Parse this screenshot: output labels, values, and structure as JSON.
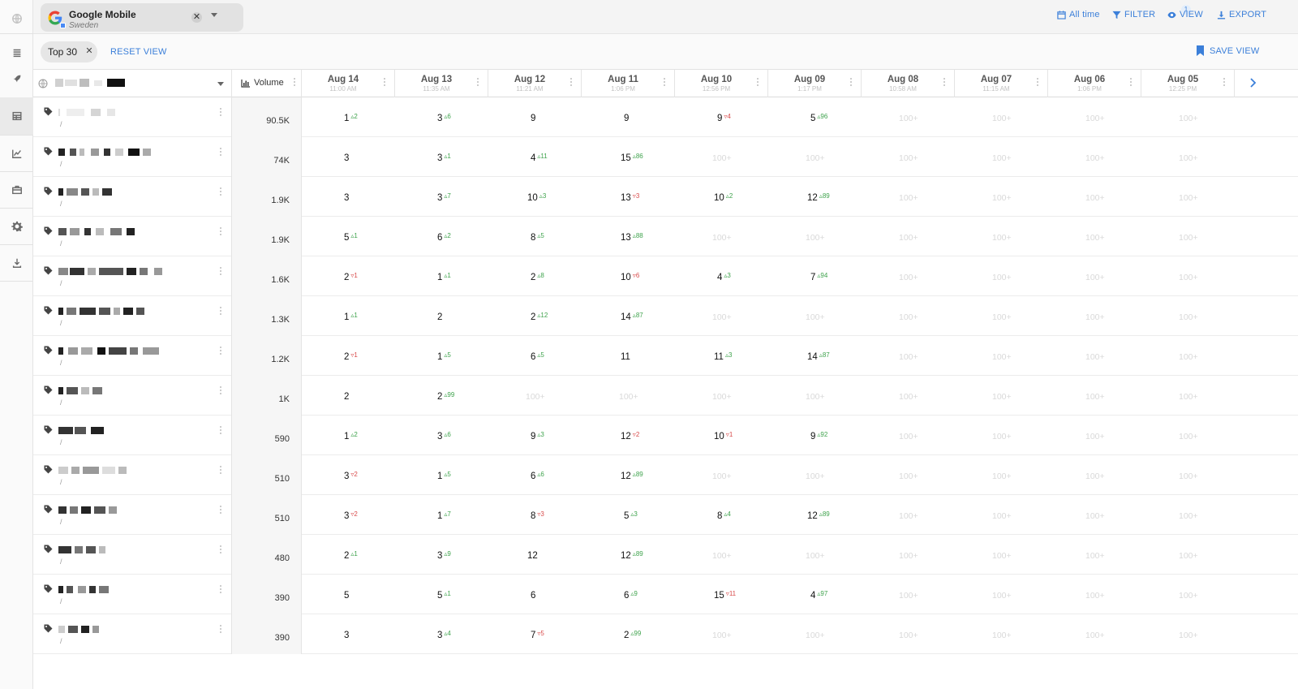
{
  "engine_chip": {
    "title": "Google Mobile",
    "subtitle": "Sweden",
    "close": "✕"
  },
  "toolbar": {
    "date_range": "All time",
    "filter": "FILTER",
    "filter_count": "1",
    "view": "VIEW",
    "export": "EXPORT"
  },
  "subbar": {
    "pill": "Top 30",
    "pill_close": "✕",
    "reset": "RESET VIEW",
    "save": "SAVE VIEW"
  },
  "table": {
    "volume_header": "Volume",
    "dates": [
      {
        "date": "Aug 14",
        "time": "11:00 AM"
      },
      {
        "date": "Aug 13",
        "time": "11:35 AM"
      },
      {
        "date": "Aug 12",
        "time": "11:21 AM"
      },
      {
        "date": "Aug 11",
        "time": "1:06 PM"
      },
      {
        "date": "Aug 10",
        "time": "12:56 PM"
      },
      {
        "date": "Aug 09",
        "time": "1:17 PM"
      },
      {
        "date": "Aug 08",
        "time": "10:58 AM"
      },
      {
        "date": "Aug 07",
        "time": "11:15 AM"
      },
      {
        "date": "Aug 06",
        "time": "1:06 PM"
      },
      {
        "date": "Aug 05",
        "time": "12:25 PM"
      }
    ],
    "rows": [
      {
        "slash": "/",
        "volume": "90.5K",
        "ranks": [
          [
            "1",
            "up",
            "2"
          ],
          [
            "3",
            "up",
            "6"
          ],
          [
            "9",
            "",
            ""
          ],
          [
            "9",
            "",
            ""
          ],
          [
            "9",
            "dn",
            "4"
          ],
          [
            "5",
            "up",
            "96"
          ],
          [
            "100+",
            "np",
            ""
          ],
          [
            "100+",
            "np",
            ""
          ],
          [
            "100+",
            "np",
            ""
          ],
          [
            "100+",
            "np",
            ""
          ]
        ]
      },
      {
        "slash": "/",
        "volume": "74K",
        "ranks": [
          [
            "3",
            "",
            ""
          ],
          [
            "3",
            "up",
            "1"
          ],
          [
            "4",
            "up",
            "11"
          ],
          [
            "15",
            "up",
            "86"
          ],
          [
            "100+",
            "np",
            ""
          ],
          [
            "100+",
            "np",
            ""
          ],
          [
            "100+",
            "np",
            ""
          ],
          [
            "100+",
            "np",
            ""
          ],
          [
            "100+",
            "np",
            ""
          ],
          [
            "100+",
            "np",
            ""
          ]
        ]
      },
      {
        "slash": "/",
        "volume": "1.9K",
        "ranks": [
          [
            "3",
            "",
            ""
          ],
          [
            "3",
            "up",
            "7"
          ],
          [
            "10",
            "up",
            "3"
          ],
          [
            "13",
            "dn",
            "3"
          ],
          [
            "10",
            "up",
            "2"
          ],
          [
            "12",
            "up",
            "89"
          ],
          [
            "100+",
            "np",
            ""
          ],
          [
            "100+",
            "np",
            ""
          ],
          [
            "100+",
            "np",
            ""
          ],
          [
            "100+",
            "np",
            ""
          ]
        ]
      },
      {
        "slash": "/",
        "volume": "1.9K",
        "ranks": [
          [
            "5",
            "up",
            "1"
          ],
          [
            "6",
            "up",
            "2"
          ],
          [
            "8",
            "up",
            "5"
          ],
          [
            "13",
            "up",
            "88"
          ],
          [
            "100+",
            "np",
            ""
          ],
          [
            "100+",
            "np",
            ""
          ],
          [
            "100+",
            "np",
            ""
          ],
          [
            "100+",
            "np",
            ""
          ],
          [
            "100+",
            "np",
            ""
          ],
          [
            "100+",
            "np",
            ""
          ]
        ]
      },
      {
        "slash": "/",
        "volume": "1.6K",
        "ranks": [
          [
            "2",
            "dn",
            "1"
          ],
          [
            "1",
            "up",
            "1"
          ],
          [
            "2",
            "up",
            "8"
          ],
          [
            "10",
            "dn",
            "6"
          ],
          [
            "4",
            "up",
            "3"
          ],
          [
            "7",
            "up",
            "94"
          ],
          [
            "100+",
            "np",
            ""
          ],
          [
            "100+",
            "np",
            ""
          ],
          [
            "100+",
            "np",
            ""
          ],
          [
            "100+",
            "np",
            ""
          ]
        ]
      },
      {
        "slash": "/",
        "volume": "1.3K",
        "ranks": [
          [
            "1",
            "up",
            "1"
          ],
          [
            "2",
            "",
            ""
          ],
          [
            "2",
            "up",
            "12"
          ],
          [
            "14",
            "up",
            "87"
          ],
          [
            "100+",
            "np",
            ""
          ],
          [
            "100+",
            "np",
            ""
          ],
          [
            "100+",
            "np",
            ""
          ],
          [
            "100+",
            "np",
            ""
          ],
          [
            "100+",
            "np",
            ""
          ],
          [
            "100+",
            "np",
            ""
          ]
        ]
      },
      {
        "slash": "/",
        "volume": "1.2K",
        "ranks": [
          [
            "2",
            "dn",
            "1"
          ],
          [
            "1",
            "up",
            "5"
          ],
          [
            "6",
            "up",
            "5"
          ],
          [
            "11",
            "",
            ""
          ],
          [
            "11",
            "up",
            "3"
          ],
          [
            "14",
            "up",
            "87"
          ],
          [
            "100+",
            "np",
            ""
          ],
          [
            "100+",
            "np",
            ""
          ],
          [
            "100+",
            "np",
            ""
          ],
          [
            "100+",
            "np",
            ""
          ]
        ]
      },
      {
        "slash": "/",
        "volume": "1K",
        "ranks": [
          [
            "2",
            "",
            ""
          ],
          [
            "2",
            "up",
            "99"
          ],
          [
            "100+",
            "np",
            ""
          ],
          [
            "100+",
            "np",
            ""
          ],
          [
            "100+",
            "np",
            ""
          ],
          [
            "100+",
            "np",
            ""
          ],
          [
            "100+",
            "np",
            ""
          ],
          [
            "100+",
            "np",
            ""
          ],
          [
            "100+",
            "np",
            ""
          ],
          [
            "100+",
            "np",
            ""
          ]
        ]
      },
      {
        "slash": "/",
        "volume": "590",
        "ranks": [
          [
            "1",
            "up",
            "2"
          ],
          [
            "3",
            "up",
            "6"
          ],
          [
            "9",
            "up",
            "3"
          ],
          [
            "12",
            "dn",
            "2"
          ],
          [
            "10",
            "dn",
            "1"
          ],
          [
            "9",
            "up",
            "92"
          ],
          [
            "100+",
            "np",
            ""
          ],
          [
            "100+",
            "np",
            ""
          ],
          [
            "100+",
            "np",
            ""
          ],
          [
            "100+",
            "np",
            ""
          ]
        ]
      },
      {
        "slash": "/",
        "volume": "510",
        "ranks": [
          [
            "3",
            "dn",
            "2"
          ],
          [
            "1",
            "up",
            "5"
          ],
          [
            "6",
            "up",
            "6"
          ],
          [
            "12",
            "up",
            "89"
          ],
          [
            "100+",
            "np",
            ""
          ],
          [
            "100+",
            "np",
            ""
          ],
          [
            "100+",
            "np",
            ""
          ],
          [
            "100+",
            "np",
            ""
          ],
          [
            "100+",
            "np",
            ""
          ],
          [
            "100+",
            "np",
            ""
          ]
        ]
      },
      {
        "slash": "/",
        "volume": "510",
        "ranks": [
          [
            "3",
            "dn",
            "2"
          ],
          [
            "1",
            "up",
            "7"
          ],
          [
            "8",
            "dn",
            "3"
          ],
          [
            "5",
            "up",
            "3"
          ],
          [
            "8",
            "up",
            "4"
          ],
          [
            "12",
            "up",
            "89"
          ],
          [
            "100+",
            "np",
            ""
          ],
          [
            "100+",
            "np",
            ""
          ],
          [
            "100+",
            "np",
            ""
          ],
          [
            "100+",
            "np",
            ""
          ]
        ]
      },
      {
        "slash": "/",
        "volume": "480",
        "ranks": [
          [
            "2",
            "up",
            "1"
          ],
          [
            "3",
            "up",
            "9"
          ],
          [
            "12",
            "",
            ""
          ],
          [
            "12",
            "up",
            "89"
          ],
          [
            "100+",
            "np",
            ""
          ],
          [
            "100+",
            "np",
            ""
          ],
          [
            "100+",
            "np",
            ""
          ],
          [
            "100+",
            "np",
            ""
          ],
          [
            "100+",
            "np",
            ""
          ],
          [
            "100+",
            "np",
            ""
          ]
        ]
      },
      {
        "slash": "/",
        "volume": "390",
        "ranks": [
          [
            "5",
            "",
            ""
          ],
          [
            "5",
            "up",
            "1"
          ],
          [
            "6",
            "",
            ""
          ],
          [
            "6",
            "up",
            "9"
          ],
          [
            "15",
            "dn",
            "11"
          ],
          [
            "4",
            "up",
            "97"
          ],
          [
            "100+",
            "np",
            ""
          ],
          [
            "100+",
            "np",
            ""
          ],
          [
            "100+",
            "np",
            ""
          ],
          [
            "100+",
            "np",
            ""
          ]
        ]
      },
      {
        "slash": "/",
        "volume": "390",
        "ranks": [
          [
            "3",
            "",
            ""
          ],
          [
            "3",
            "up",
            "4"
          ],
          [
            "7",
            "dn",
            "5"
          ],
          [
            "2",
            "up",
            "99"
          ],
          [
            "100+",
            "np",
            ""
          ],
          [
            "100+",
            "np",
            ""
          ],
          [
            "100+",
            "np",
            ""
          ],
          [
            "100+",
            "np",
            ""
          ],
          [
            "100+",
            "np",
            ""
          ],
          [
            "100+",
            "np",
            ""
          ]
        ]
      }
    ]
  }
}
